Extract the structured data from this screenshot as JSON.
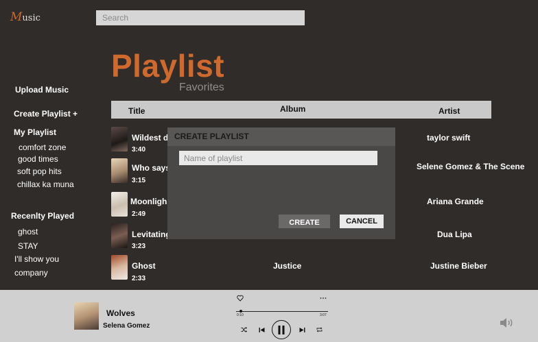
{
  "app": {
    "logo_m": "M",
    "logo_rest": "usic"
  },
  "search": {
    "placeholder": "Search"
  },
  "sidebar": {
    "upload": "Upload Music",
    "create_playlist": "Create Playlist +",
    "my_playlist": "My Playlist",
    "playlists": [
      "comfort zone",
      "good times",
      "soft pop hits",
      "chillax ka muna"
    ],
    "recently_played": "Recenlty Played",
    "recent": [
      "ghost",
      "STAY",
      "I'll show you",
      "company"
    ]
  },
  "main": {
    "title": "Playlist",
    "subtitle": "Favorites",
    "columns": {
      "title": "Title",
      "album": "Album",
      "artist": "Artist"
    }
  },
  "rows": [
    {
      "title": "Wildest d",
      "duration": "3:40",
      "album": "",
      "artist": "taylor swift"
    },
    {
      "title": "Who says",
      "duration": "3:15",
      "album": "",
      "artist": "Selene Gomez & The Scene"
    },
    {
      "title": "Moonligh",
      "duration": "2:49",
      "album": "",
      "artist": "Ariana Grande"
    },
    {
      "title": "Levitating",
      "duration": "3:23",
      "album": "",
      "artist": "Dua Lipa"
    },
    {
      "title": "Ghost",
      "duration": "2:33",
      "album": "Justice",
      "artist": "Justine Bieber"
    }
  ],
  "modal": {
    "title": "CREATE PLAYLIST",
    "input_placeholder": "Name of playlist",
    "input_value": "",
    "create": "CREATE",
    "cancel": "CANCEL"
  },
  "player": {
    "title": "Wolves",
    "artist": "Selena Gomez",
    "time_elapsed": "0:10",
    "time_total": "3:07",
    "progress": 0.05,
    "icons": [
      "heart-icon",
      "more-icon",
      "shuffle-icon",
      "previous-icon",
      "pause-icon",
      "next-icon",
      "repeat-icon",
      "volume-icon"
    ]
  },
  "colors": {
    "background": "#2f2c2a",
    "accent": "#d0692d",
    "header_bar": "#c9c9c9",
    "player_bar": "#d0d0d0"
  }
}
